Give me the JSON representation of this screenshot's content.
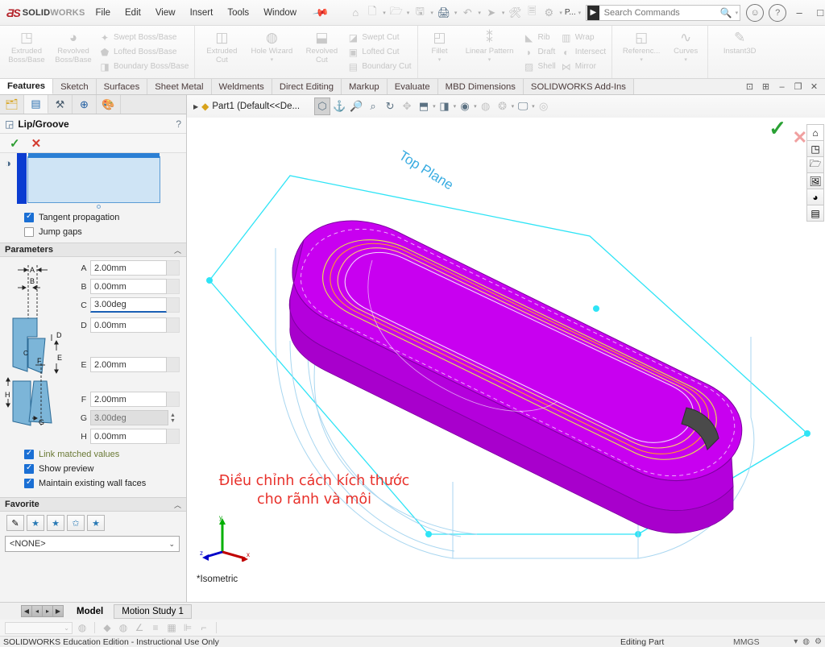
{
  "app": {
    "brand_ds": "ƋS",
    "brand_solid": "SOLID",
    "brand_works": "WORKS",
    "menus": [
      "File",
      "Edit",
      "View",
      "Insert",
      "Tools",
      "Window"
    ],
    "pin_icon": "pin-icon"
  },
  "quick_access": {
    "icons": [
      "home-icon",
      "new-document-icon",
      "open-folder-icon",
      "save-icon",
      "print-icon",
      "undo-icon",
      "select-cursor-icon",
      "rebuild-icon",
      "file-properties-icon",
      "options-gear-icon"
    ],
    "overflow_label": "P..."
  },
  "search": {
    "placeholder": "Search Commands",
    "icon": "solidworks-search-icon",
    "magnifier": "search-icon",
    "caret": "chevron-down-icon"
  },
  "window_controls": {
    "account_icon": "user-account-icon",
    "help_icon": "help-icon",
    "minimize": "–",
    "maximize": "□",
    "close": "✕"
  },
  "ribbon": {
    "groups": [
      {
        "name": "boss-base",
        "big": [
          {
            "label": "Extruded\nBoss/Base",
            "icon": "extruded-boss-icon",
            "caret": true
          },
          {
            "label": "Revolved\nBoss/Base",
            "icon": "revolved-boss-icon",
            "caret": true
          }
        ],
        "small": [
          {
            "label": "Swept Boss/Base",
            "icon": "swept-boss-icon"
          },
          {
            "label": "Lofted Boss/Base",
            "icon": "lofted-boss-icon"
          },
          {
            "label": "Boundary Boss/Base",
            "icon": "boundary-boss-icon"
          }
        ]
      },
      {
        "name": "cut",
        "big": [
          {
            "label": "Extruded\nCut",
            "icon": "extruded-cut-icon",
            "caret": true
          },
          {
            "label": "Hole Wizard",
            "icon": "hole-wizard-icon",
            "caret": true
          },
          {
            "label": "Revolved\nCut",
            "icon": "revolved-cut-icon",
            "caret": false
          }
        ],
        "small": [
          {
            "label": "Swept Cut",
            "icon": "swept-cut-icon"
          },
          {
            "label": "Lofted Cut",
            "icon": "lofted-cut-icon"
          },
          {
            "label": "Boundary Cut",
            "icon": "boundary-cut-icon"
          }
        ]
      },
      {
        "name": "features",
        "big": [
          {
            "label": "Fillet",
            "icon": "fillet-icon",
            "caret": true
          },
          {
            "label": "Linear Pattern",
            "icon": "linear-pattern-icon",
            "caret": true
          }
        ],
        "small": [
          {
            "label": "Rib",
            "icon": "rib-icon"
          },
          {
            "label": "Draft",
            "icon": "draft-icon"
          },
          {
            "label": "Shell",
            "icon": "shell-icon"
          }
        ],
        "small2": [
          {
            "label": "Wrap",
            "icon": "wrap-icon"
          },
          {
            "label": "Intersect",
            "icon": "intersect-icon"
          },
          {
            "label": "Mirror",
            "icon": "mirror-icon"
          }
        ]
      },
      {
        "name": "reference",
        "big": [
          {
            "label": "Referenc...",
            "icon": "reference-geometry-icon",
            "caret": true
          },
          {
            "label": "Curves",
            "icon": "curves-icon",
            "caret": true
          }
        ],
        "small": []
      },
      {
        "name": "instant3d",
        "big": [
          {
            "label": "Instant3D",
            "icon": "instant3d-icon",
            "caret": false
          }
        ],
        "small": []
      }
    ]
  },
  "tabs": {
    "items": [
      "Features",
      "Sketch",
      "Surfaces",
      "Sheet Metal",
      "Weldments",
      "Direct Editing",
      "Markup",
      "Evaluate",
      "MBD Dimensions",
      "SOLIDWORKS Add-Ins"
    ],
    "active": "Features",
    "doc_controls": [
      "restore-down-icon",
      "restore-icon",
      "minimize-icon",
      "restore-window-icon",
      "close-document-icon"
    ]
  },
  "property_manager": {
    "tabs": [
      "feature-manager-tree-icon",
      "property-manager-icon",
      "configuration-manager-icon",
      "dimxpert-manager-icon",
      "display-manager-icon"
    ],
    "active_tab_index": 1,
    "title": "Lip/Groove",
    "title_icon": "lip-groove-icon",
    "help_icon": "help-icon",
    "ok_icon": "check-icon",
    "cancel_icon": "close-icon",
    "selection": {
      "label": "selection-listbox",
      "icon": "face-select-icon"
    },
    "checkboxes_top": [
      {
        "label": "Tangent propagation",
        "checked": true
      },
      {
        "label": "Jump gaps",
        "checked": false
      }
    ],
    "parameters": {
      "title": "Parameters",
      "diagram_icon": "lip-groove-diagram",
      "rows": [
        {
          "label": "A",
          "value": "2.00mm",
          "state": "normal"
        },
        {
          "label": "B",
          "value": "0.00mm",
          "state": "normal"
        },
        {
          "label": "C",
          "value": "3.00deg",
          "state": "focused"
        },
        {
          "label": "D",
          "value": "0.00mm",
          "state": "normal"
        },
        {
          "label": "E",
          "value": "2.00mm",
          "state": "normal"
        },
        {
          "label": "F",
          "value": "2.00mm",
          "state": "normal"
        },
        {
          "label": "G",
          "value": "3.00deg",
          "state": "disabled"
        },
        {
          "label": "H",
          "value": "0.00mm",
          "state": "normal"
        }
      ]
    },
    "checkboxes_bottom": [
      {
        "label": "Link matched values",
        "checked": true,
        "color": "#6b7a36"
      },
      {
        "label": "Show preview",
        "checked": true,
        "color": "#222222"
      },
      {
        "label": "Maintain existing wall faces",
        "checked": true,
        "color": "#222222"
      }
    ],
    "favorite": {
      "title": "Favorite",
      "buttons": [
        "apply-favorite-icon",
        "add-favorite-icon",
        "delete-favorite-icon",
        "save-favorite-icon",
        "load-favorite-icon"
      ],
      "selected": "<NONE>",
      "chevron": "chevron-down-icon"
    }
  },
  "graphics": {
    "tree_item": "Part1  (Default<<De...",
    "tree_icon": "part-icon",
    "tree_arrow": "expand-arrow-icon",
    "view_tools": [
      {
        "icon": "zoom-to-fit-icon",
        "selected": true
      },
      {
        "icon": "zoom-to-area-icon",
        "selected": false
      },
      {
        "icon": "magnifier-icon",
        "selected": false
      },
      {
        "icon": "zoom-in-out-icon",
        "selected": false
      },
      {
        "icon": "rotate-view-icon",
        "selected": false
      },
      {
        "icon": "pan-icon",
        "selected": false
      },
      {
        "icon": "view-orientation-icon",
        "selected": false,
        "caret": true
      },
      {
        "icon": "display-style-icon",
        "selected": false,
        "caret": true
      },
      {
        "icon": "hide-show-items-icon",
        "selected": false,
        "caret": true
      },
      {
        "icon": "edit-appearance-icon",
        "selected": false
      },
      {
        "icon": "apply-scene-icon",
        "selected": false,
        "caret": true
      },
      {
        "icon": "view-settings-icon",
        "selected": false,
        "caret": true
      },
      {
        "icon": "section-view-icon",
        "selected": false
      }
    ],
    "plane_label": "Top Plane",
    "annotation_line1": "Điều chỉnh cách kích thước",
    "annotation_line2": "cho rãnh và môi",
    "view_orientation": "*Isometric",
    "triad": {
      "x": "x",
      "y": "y",
      "z": "z"
    },
    "model_color": "#c800f0",
    "sketch_color": "#00d9ff",
    "confirm_check": "confirm-check-icon",
    "confirm_x": "confirm-cancel-icon",
    "right_toolbar": [
      "home-icon",
      "box-icon",
      "folder-icon",
      "appearances-icon",
      "color-wheel-icon",
      "display-pane-icon"
    ]
  },
  "bottom": {
    "nav_buttons": [
      "first-icon",
      "previous-icon",
      "next-icon",
      "last-icon"
    ],
    "tabs": [
      {
        "label": "Model",
        "active": true
      },
      {
        "label": "Motion Study 1",
        "active": false
      }
    ],
    "tool_icons": [
      "select-filter-dropdown",
      "filter-icon",
      "shaded-icon",
      "shaded-edges-icon",
      "edit-sketch-icon",
      "list-icon",
      "table-icon",
      "measure-icon",
      "section-icon"
    ]
  },
  "status": {
    "edition": "SOLIDWORKS Education Edition - Instructional Use Only",
    "mode": "Editing Part",
    "units": "MMGS",
    "unit_caret": "chevron-down-icon",
    "status_icons": [
      "overwrite-icon",
      "options-icon"
    ]
  }
}
